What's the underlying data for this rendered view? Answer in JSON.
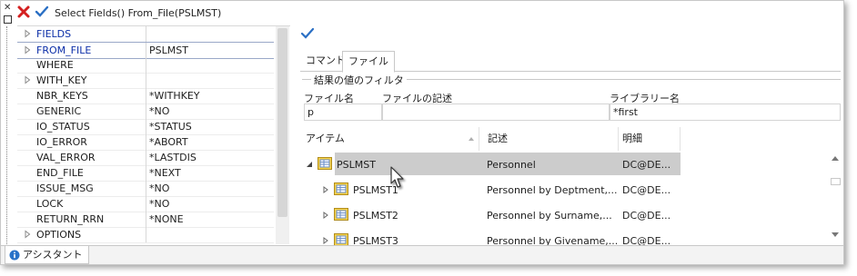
{
  "toolbar": {
    "command_text": "Select Fields() From_File(PSLMST)",
    "cancel_icon": "red-x-icon",
    "ok_icon": "blue-check-icon"
  },
  "property_grid": {
    "rows": [
      {
        "name": "FIELDS",
        "value": "",
        "expandable": true,
        "blue": true
      },
      {
        "name": "FROM_FILE",
        "value": "PSLMST",
        "expandable": true,
        "blue": true
      },
      {
        "name": "WHERE",
        "value": "",
        "expandable": false,
        "blue": false
      },
      {
        "name": "WITH_KEY",
        "value": "",
        "expandable": true,
        "blue": false
      },
      {
        "name": "NBR_KEYS",
        "value": "*WITHKEY",
        "expandable": false,
        "blue": false
      },
      {
        "name": "GENERIC",
        "value": "*NO",
        "expandable": false,
        "blue": false
      },
      {
        "name": "IO_STATUS",
        "value": "*STATUS",
        "expandable": false,
        "blue": false
      },
      {
        "name": "IO_ERROR",
        "value": "*ABORT",
        "expandable": false,
        "blue": false
      },
      {
        "name": "VAL_ERROR",
        "value": "*LASTDIS",
        "expandable": false,
        "blue": false
      },
      {
        "name": "END_FILE",
        "value": "*NEXT",
        "expandable": false,
        "blue": false
      },
      {
        "name": "ISSUE_MSG",
        "value": "*NO",
        "expandable": false,
        "blue": false
      },
      {
        "name": "LOCK",
        "value": "*NO",
        "expandable": false,
        "blue": false
      },
      {
        "name": "RETURN_RRN",
        "value": "*NONE",
        "expandable": false,
        "blue": false
      },
      {
        "name": "OPTIONS",
        "value": "",
        "expandable": true,
        "blue": false
      }
    ]
  },
  "assistant": {
    "tabs": [
      "コマンド",
      "ファイル"
    ],
    "active_tab": "ファイル",
    "filter": {
      "legend": "結果の値のフィルタ",
      "file_name_label": "ファイル名",
      "file_name_value": "p",
      "file_desc_label": "ファイルの記述",
      "file_desc_value": "",
      "library_label": "ライブラリー名",
      "library_value": "*first"
    },
    "columns": [
      "アイテム",
      "記述",
      "明細"
    ],
    "items": [
      {
        "name": "PSLMST",
        "desc": "Personnel",
        "detail": "DC@DE...",
        "expanded": true,
        "selected": true,
        "level": 0
      },
      {
        "name": "PSLMST1",
        "desc": "Personnel by Deptment,...",
        "detail": "DC@DE...",
        "expanded": false,
        "selected": false,
        "level": 1
      },
      {
        "name": "PSLMST2",
        "desc": "Personnel by Surname,...",
        "detail": "DC@DE...",
        "expanded": false,
        "selected": false,
        "level": 1
      },
      {
        "name": "PSLMST3",
        "desc": "Personnel by Givename,...",
        "detail": "DC@DE...",
        "expanded": false,
        "selected": false,
        "level": 1
      }
    ]
  },
  "bottom_tab": {
    "label": "アシスタント",
    "icon": "info-icon"
  }
}
